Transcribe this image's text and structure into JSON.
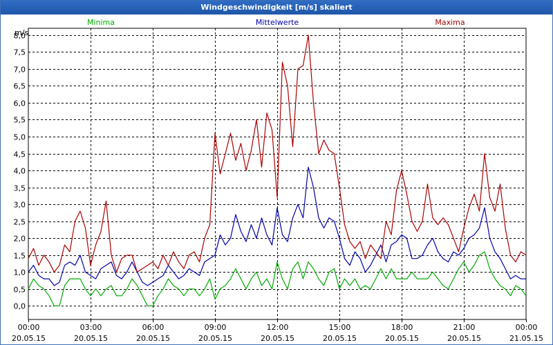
{
  "window": {
    "title": "Windgeschwindigkeit [m/s] skaliert"
  },
  "chart_data": {
    "type": "line",
    "title": "Windgeschwindigkeit [m/s] skaliert",
    "ylabel": "m/s",
    "xlabel": "",
    "ylim": [
      -0.4,
      8.2
    ],
    "xlim": [
      0,
      24
    ],
    "grid": true,
    "y_ticks": [
      "8,0",
      "7,5",
      "7,0",
      "6,5",
      "6,0",
      "5,5",
      "5,0",
      "4,5",
      "4,0",
      "3,5",
      "3,0",
      "2,5",
      "2,0",
      "1,5",
      "1,0",
      "0,5",
      "0,0"
    ],
    "y_tick_values": [
      8,
      7.5,
      7,
      6.5,
      6,
      5.5,
      5,
      4.5,
      4,
      3.5,
      3,
      2.5,
      2,
      1.5,
      1,
      0.5,
      0
    ],
    "x_ticks": [
      {
        "time": "00:00",
        "date": "20.05.15"
      },
      {
        "time": "03:00",
        "date": "20.05.15"
      },
      {
        "time": "06:00",
        "date": "20.05.15"
      },
      {
        "time": "09:00",
        "date": "20.05.15"
      },
      {
        "time": "12:00",
        "date": "20.05.15"
      },
      {
        "time": "15:00",
        "date": "20.05.15"
      },
      {
        "time": "18:00",
        "date": "20.05.15"
      },
      {
        "time": "21:00",
        "date": "20.05.15"
      },
      {
        "time": "00:00",
        "date": "21.05.15"
      }
    ],
    "x_tick_values": [
      0,
      3,
      6,
      9,
      12,
      15,
      18,
      21,
      24
    ],
    "x_unit": "hours since 20.05.15 00:00",
    "series": [
      {
        "name": "Minima",
        "color": "#00aa00",
        "x": [
          0,
          0.25,
          0.5,
          0.75,
          1,
          1.25,
          1.5,
          1.75,
          2,
          2.25,
          2.5,
          2.75,
          3,
          3.25,
          3.5,
          3.75,
          4,
          4.25,
          4.5,
          4.75,
          5,
          5.25,
          5.5,
          5.75,
          6,
          6.25,
          6.5,
          6.75,
          7,
          7.25,
          7.5,
          7.75,
          8,
          8.25,
          8.5,
          8.75,
          9,
          9.25,
          9.5,
          9.75,
          10,
          10.25,
          10.5,
          10.75,
          11,
          11.25,
          11.5,
          11.75,
          12,
          12.25,
          12.5,
          12.75,
          13,
          13.25,
          13.5,
          13.75,
          14,
          14.25,
          14.5,
          14.75,
          15,
          15.25,
          15.5,
          15.75,
          16,
          16.25,
          16.5,
          16.75,
          17,
          17.25,
          17.5,
          17.75,
          18,
          18.25,
          18.5,
          18.75,
          19,
          19.25,
          19.5,
          19.75,
          20,
          20.25,
          20.5,
          20.75,
          21,
          21.25,
          21.5,
          21.75,
          22,
          22.25,
          22.5,
          22.75,
          23,
          23.25,
          23.5,
          23.75,
          24
        ],
        "values": [
          0.5,
          0.8,
          0.6,
          0.5,
          0.3,
          0,
          0,
          0.6,
          0.8,
          0.8,
          0.8,
          0.5,
          0.3,
          0.5,
          0.3,
          0.5,
          0.6,
          0.3,
          0.3,
          0.5,
          0.8,
          0.6,
          0.3,
          0,
          0,
          0.3,
          0.5,
          0.8,
          0.6,
          0.5,
          0.3,
          0.5,
          0.5,
          0.3,
          0.5,
          0.8,
          0.2,
          0.5,
          0.6,
          0.8,
          1.1,
          0.8,
          0.5,
          0.8,
          1.0,
          0.6,
          0.8,
          0.5,
          1.3,
          0.8,
          0.5,
          1.1,
          1.3,
          0.8,
          1.3,
          1.1,
          0.8,
          0.6,
          1.0,
          1.1,
          0.5,
          0.8,
          0.6,
          0.8,
          0.5,
          0.6,
          0.5,
          0.8,
          1.1,
          0.8,
          1.1,
          0.8,
          0.8,
          0.8,
          1.0,
          0.8,
          0.8,
          0.8,
          1.0,
          0.8,
          0.6,
          0.5,
          0.8,
          1.1,
          1.3,
          1.0,
          1.2,
          1.5,
          1.6,
          1.1,
          0.8,
          0.6,
          0.5,
          0.3,
          0.6,
          0.5,
          0.3
        ]
      },
      {
        "name": "Mittelwerte",
        "color": "#0000aa",
        "x": [
          0,
          0.25,
          0.5,
          0.75,
          1,
          1.25,
          1.5,
          1.75,
          2,
          2.25,
          2.5,
          2.75,
          3,
          3.25,
          3.5,
          3.75,
          4,
          4.25,
          4.5,
          4.75,
          5,
          5.25,
          5.5,
          5.75,
          6,
          6.25,
          6.5,
          6.75,
          7,
          7.25,
          7.5,
          7.75,
          8,
          8.25,
          8.5,
          8.75,
          9,
          9.25,
          9.5,
          9.75,
          10,
          10.25,
          10.5,
          10.75,
          11,
          11.25,
          11.5,
          11.75,
          12,
          12.25,
          12.5,
          12.75,
          13,
          13.25,
          13.5,
          13.75,
          14,
          14.25,
          14.5,
          14.75,
          15,
          15.25,
          15.5,
          15.75,
          16,
          16.25,
          16.5,
          16.75,
          17,
          17.25,
          17.5,
          17.75,
          18,
          18.25,
          18.5,
          18.75,
          19,
          19.25,
          19.5,
          19.75,
          20,
          20.25,
          20.5,
          20.75,
          21,
          21.25,
          21.5,
          21.75,
          22,
          22.25,
          22.5,
          22.75,
          23,
          23.25,
          23.5,
          23.75,
          24
        ],
        "values": [
          1.0,
          1.2,
          0.9,
          0.8,
          0.8,
          0.6,
          0.7,
          1.2,
          1.3,
          1.2,
          1.5,
          1.0,
          0.9,
          0.8,
          1.1,
          1.2,
          1.3,
          0.9,
          0.8,
          1.0,
          1.3,
          1.0,
          0.7,
          0.6,
          0.7,
          0.8,
          0.9,
          1.2,
          1.0,
          0.8,
          0.9,
          1.1,
          1.0,
          0.9,
          1.3,
          1.4,
          1.5,
          2.1,
          1.8,
          2.0,
          2.7,
          2.2,
          1.9,
          2.4,
          2.0,
          2.6,
          2.1,
          1.8,
          2.9,
          2.1,
          1.9,
          2.6,
          3.0,
          2.6,
          4.1,
          3.5,
          2.6,
          2.3,
          2.6,
          2.5,
          2.0,
          1.4,
          1.2,
          1.6,
          1.4,
          1.0,
          1.2,
          1.5,
          1.8,
          1.3,
          1.8,
          1.9,
          2.1,
          2.0,
          1.4,
          1.4,
          1.5,
          1.8,
          2.0,
          1.6,
          1.4,
          1.3,
          1.6,
          1.5,
          1.7,
          2.0,
          2.1,
          2.3,
          2.9,
          2.0,
          1.6,
          1.4,
          1.1,
          0.8,
          0.9,
          0.8,
          0.8
        ]
      },
      {
        "name": "Maxima",
        "color": "#aa0000",
        "x": [
          0,
          0.25,
          0.5,
          0.75,
          1,
          1.25,
          1.5,
          1.75,
          2,
          2.25,
          2.5,
          2.75,
          3,
          3.25,
          3.5,
          3.75,
          4,
          4.25,
          4.5,
          4.75,
          5,
          5.25,
          5.5,
          5.75,
          6,
          6.25,
          6.5,
          6.75,
          7,
          7.25,
          7.5,
          7.75,
          8,
          8.25,
          8.5,
          8.75,
          9,
          9.25,
          9.5,
          9.75,
          10,
          10.25,
          10.5,
          10.75,
          11,
          11.25,
          11.5,
          11.75,
          12,
          12.25,
          12.5,
          12.75,
          13,
          13.25,
          13.5,
          13.75,
          14,
          14.25,
          14.5,
          14.75,
          15,
          15.25,
          15.5,
          15.75,
          16,
          16.25,
          16.5,
          16.75,
          17,
          17.25,
          17.5,
          17.75,
          18,
          18.25,
          18.5,
          18.75,
          19,
          19.25,
          19.5,
          19.75,
          20,
          20.25,
          20.5,
          20.75,
          21,
          21.25,
          21.5,
          21.75,
          22,
          22.25,
          22.5,
          22.75,
          23,
          23.25,
          23.5,
          23.75,
          24
        ],
        "values": [
          1.4,
          1.7,
          1.2,
          1.5,
          1.3,
          1.0,
          1.2,
          1.8,
          1.6,
          2.5,
          2.8,
          2.3,
          1.2,
          1.8,
          2.2,
          3.1,
          1.5,
          1.0,
          1.4,
          1.5,
          1.5,
          1.0,
          1.1,
          1.2,
          1.3,
          1.1,
          1.5,
          1.2,
          1.6,
          1.3,
          1.1,
          1.5,
          1.6,
          1.3,
          2.0,
          2.4,
          5.1,
          3.9,
          4.5,
          5.1,
          4.3,
          4.8,
          4.0,
          4.6,
          5.5,
          4.1,
          5.7,
          5.2,
          3.2,
          7.2,
          6.5,
          4.7,
          7.0,
          7.1,
          8.0,
          6.0,
          4.5,
          4.9,
          4.6,
          4.5,
          3.5,
          2.4,
          1.9,
          1.7,
          1.9,
          1.4,
          1.8,
          1.6,
          1.4,
          2.5,
          2.1,
          3.4,
          4.0,
          3.3,
          2.5,
          2.2,
          2.5,
          3.6,
          2.6,
          2.4,
          2.6,
          2.4,
          2.0,
          1.6,
          2.3,
          2.9,
          3.3,
          2.8,
          4.5,
          3.2,
          2.8,
          3.6,
          2.3,
          1.5,
          1.3,
          1.6,
          1.5
        ]
      }
    ]
  }
}
